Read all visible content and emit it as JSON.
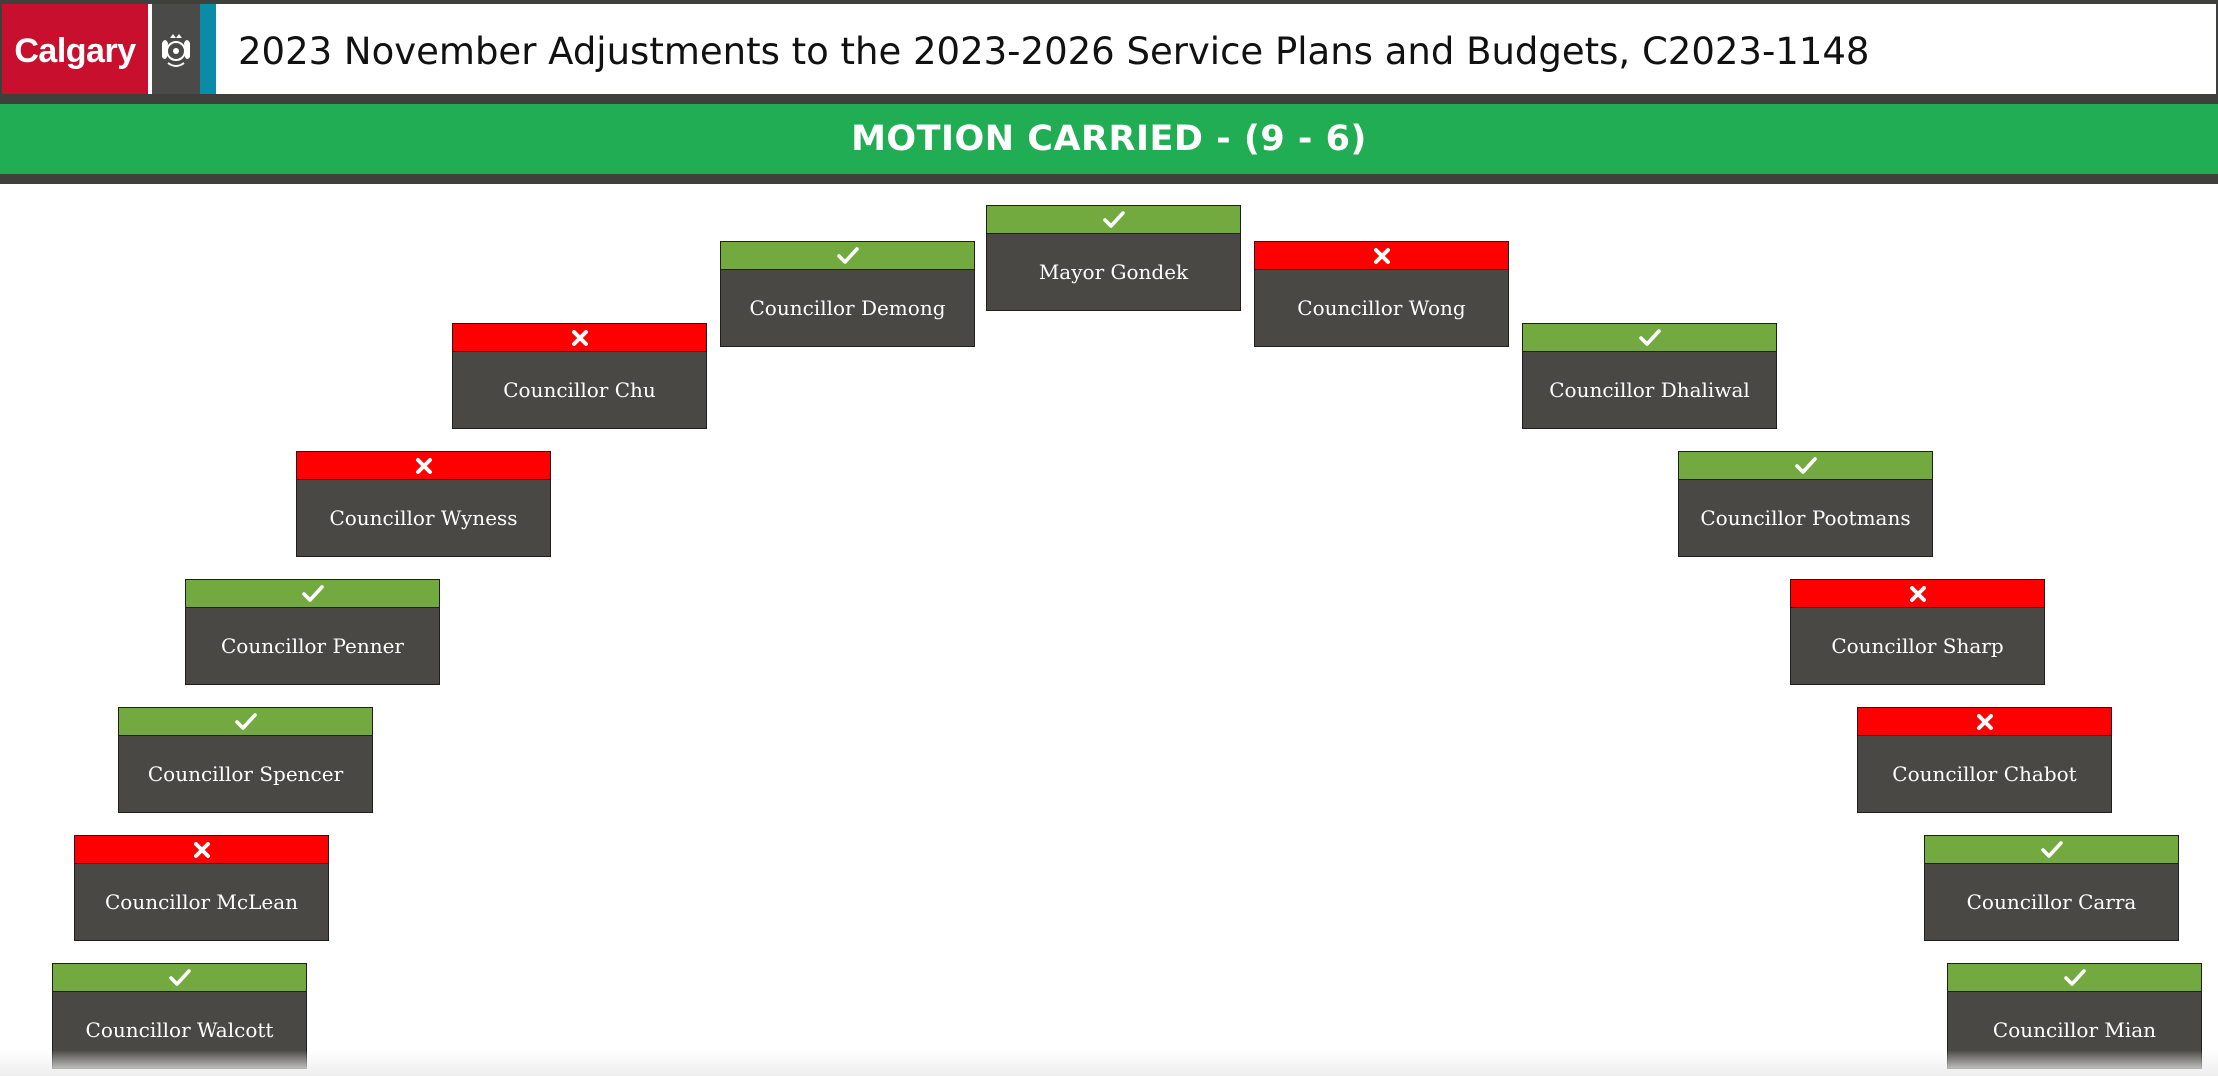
{
  "header": {
    "logo_text": "Calgary",
    "title": "2023 November Adjustments to the 2023-2026 Service Plans and Budgets, C2023-1148"
  },
  "result": {
    "label": "MOTION CARRIED - (9 - 6)",
    "color": "#21ad53"
  },
  "colors": {
    "yes": "#72aa40",
    "no": "#ff0000",
    "card": "#494844"
  },
  "votes": [
    {
      "name": "Mayor Gondek",
      "vote": "yes",
      "icon": "check-icon"
    },
    {
      "name": "Councillor Demong",
      "vote": "yes",
      "icon": "check-icon"
    },
    {
      "name": "Councillor Wong",
      "vote": "no",
      "icon": "x-icon"
    },
    {
      "name": "Councillor Chu",
      "vote": "no",
      "icon": "x-icon"
    },
    {
      "name": "Councillor Dhaliwal",
      "vote": "yes",
      "icon": "check-icon"
    },
    {
      "name": "Councillor Wyness",
      "vote": "no",
      "icon": "x-icon"
    },
    {
      "name": "Councillor Pootmans",
      "vote": "yes",
      "icon": "check-icon"
    },
    {
      "name": "Councillor Penner",
      "vote": "yes",
      "icon": "check-icon"
    },
    {
      "name": "Councillor Sharp",
      "vote": "no",
      "icon": "x-icon"
    },
    {
      "name": "Councillor Spencer",
      "vote": "yes",
      "icon": "check-icon"
    },
    {
      "name": "Councillor Chabot",
      "vote": "no",
      "icon": "x-icon"
    },
    {
      "name": "Councillor McLean",
      "vote": "no",
      "icon": "x-icon"
    },
    {
      "name": "Councillor Carra",
      "vote": "yes",
      "icon": "check-icon"
    },
    {
      "name": "Councillor Walcott",
      "vote": "yes",
      "icon": "check-icon"
    },
    {
      "name": "Councillor Mian",
      "vote": "yes",
      "icon": "check-icon"
    }
  ]
}
